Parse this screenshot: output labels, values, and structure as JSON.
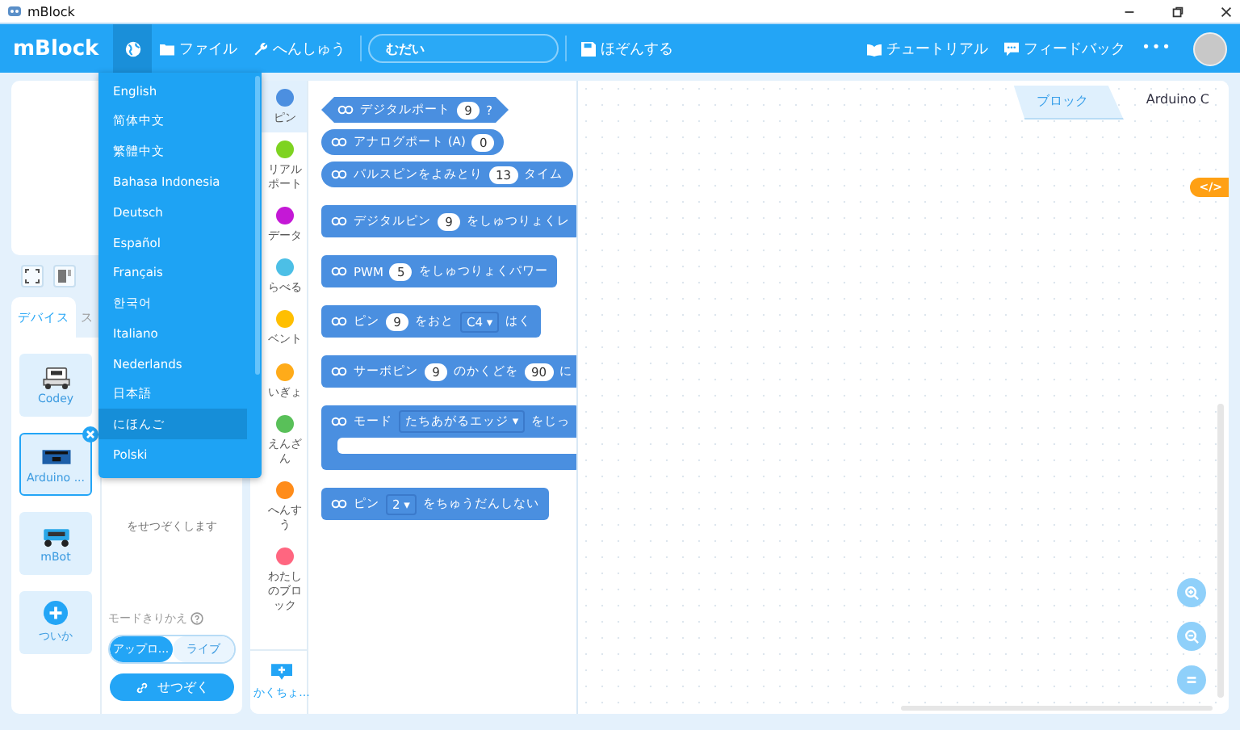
{
  "window": {
    "title": "mBlock"
  },
  "menu_bar": {
    "logo": "mBlock",
    "language_open": true,
    "items": [
      {
        "kind": "folder",
        "label": "ファイル"
      },
      {
        "kind": "wrench",
        "label": "へんしゅう"
      }
    ],
    "project_title": {
      "value": "むだい"
    },
    "save": {
      "kind": "save",
      "label": "ほぞんする"
    },
    "right_items": [
      {
        "kind": "book",
        "label": "チュートリアル"
      },
      {
        "kind": "chat",
        "label": "フィードバック"
      },
      {
        "kind": "more",
        "label": "•••"
      }
    ]
  },
  "language_menu": {
    "items": [
      {
        "label": "English",
        "selected": false
      },
      {
        "label": "简体中文",
        "selected": false
      },
      {
        "label": "繁體中文",
        "selected": false
      },
      {
        "label": "Bahasa Indonesia",
        "selected": false
      },
      {
        "label": "Deutsch",
        "selected": false
      },
      {
        "label": "Español",
        "selected": false
      },
      {
        "label": "Français",
        "selected": false
      },
      {
        "label": "한국어",
        "selected": false
      },
      {
        "label": "Italiano",
        "selected": false
      },
      {
        "label": "Nederlands",
        "selected": false
      },
      {
        "label": "日本語",
        "selected": false
      },
      {
        "label": "にほんご",
        "selected": true
      },
      {
        "label": "Polski",
        "selected": false
      }
    ]
  },
  "device_panel": {
    "tabs": [
      {
        "label": "デバイス",
        "selected": true
      },
      {
        "label": "ス",
        "selected": false
      }
    ],
    "devices": [
      {
        "kind": "robot",
        "name": "Codey",
        "selected": false
      },
      {
        "kind": "board",
        "name": "Arduino ...",
        "selected": true
      },
      {
        "kind": "car",
        "name": "mBot",
        "selected": false
      }
    ],
    "add_label": "ついか",
    "hint": "をせつぞくします",
    "mode_label": "モードきりかえ",
    "modes": [
      {
        "label": "アップロ...",
        "selected": true
      },
      {
        "label": "ライブ",
        "selected": false
      }
    ],
    "connect_button": "せつぞく"
  },
  "categories": [
    {
      "label": "ピン",
      "color": "#4c8fe0",
      "selected": true
    },
    {
      "label": "リアルポート",
      "color": "#7ed321",
      "selected": false
    },
    {
      "label": "データ",
      "color": "#c418d6",
      "selected": false
    },
    {
      "label": "らべる",
      "color": "#4cbfe6",
      "selected": false
    },
    {
      "label": "ベント",
      "color": "#ffbf00",
      "selected": false
    },
    {
      "label": "いぎょ",
      "color": "#ffab19",
      "selected": false
    },
    {
      "label": "えんざん",
      "color": "#59c059",
      "selected": false
    },
    {
      "label": "へんすう",
      "color": "#ff8c1a",
      "selected": false
    },
    {
      "label": "わたしのブロック",
      "color": "#ff6680",
      "selected": false
    }
  ],
  "extension_button": "かくちょ...",
  "blocks": [
    {
      "kind": "boolean",
      "parts": [
        {
          "kind": "text",
          "value": "デジタルポート"
        },
        {
          "kind": "number",
          "value": "9"
        },
        {
          "kind": "text",
          "value": "?"
        }
      ]
    },
    {
      "kind": "reporter",
      "parts": [
        {
          "kind": "text",
          "value": "アナログポート (A)"
        },
        {
          "kind": "number",
          "value": "0"
        }
      ]
    },
    {
      "kind": "reporter",
      "parts": [
        {
          "kind": "text",
          "value": "パルスピンをよみとり"
        },
        {
          "kind": "number",
          "value": "13"
        },
        {
          "kind": "text",
          "value": "タイム"
        }
      ]
    },
    {
      "kind": "command",
      "parts": [
        {
          "kind": "text",
          "value": "デジタルピン"
        },
        {
          "kind": "number",
          "value": "9"
        },
        {
          "kind": "text",
          "value": "をしゅつりょくレ"
        }
      ]
    },
    {
      "kind": "command",
      "parts": [
        {
          "kind": "text",
          "value": "PWM"
        },
        {
          "kind": "number",
          "value": "5"
        },
        {
          "kind": "text",
          "value": "をしゅつりょくパワー"
        }
      ]
    },
    {
      "kind": "command",
      "parts": [
        {
          "kind": "text",
          "value": "ピン"
        },
        {
          "kind": "number",
          "value": "9"
        },
        {
          "kind": "text",
          "value": "をおと"
        },
        {
          "kind": "dropdown",
          "value": "C4 ▾"
        },
        {
          "kind": "text",
          "value": "はく"
        }
      ]
    },
    {
      "kind": "command",
      "parts": [
        {
          "kind": "text",
          "value": "サーボピン"
        },
        {
          "kind": "number",
          "value": "9"
        },
        {
          "kind": "text",
          "value": "のかくどを"
        },
        {
          "kind": "number",
          "value": "90"
        },
        {
          "kind": "text",
          "value": "に"
        }
      ]
    },
    {
      "kind": "c",
      "parts": [
        {
          "kind": "text",
          "value": "モード"
        },
        {
          "kind": "dropdown",
          "value": "たちあがるエッジ ▾"
        },
        {
          "kind": "text",
          "value": "をじっ"
        }
      ]
    },
    {
      "kind": "command",
      "parts": [
        {
          "kind": "text",
          "value": "ピン"
        },
        {
          "kind": "dropdown",
          "value": "2 ▾"
        },
        {
          "kind": "text",
          "value": "をちゅうだんしない"
        }
      ]
    }
  ],
  "workspace": {
    "tabs": [
      {
        "label": "ブロック",
        "selected": true
      },
      {
        "label": "Arduino C",
        "selected": false
      }
    ],
    "code_toggle": "</>"
  }
}
